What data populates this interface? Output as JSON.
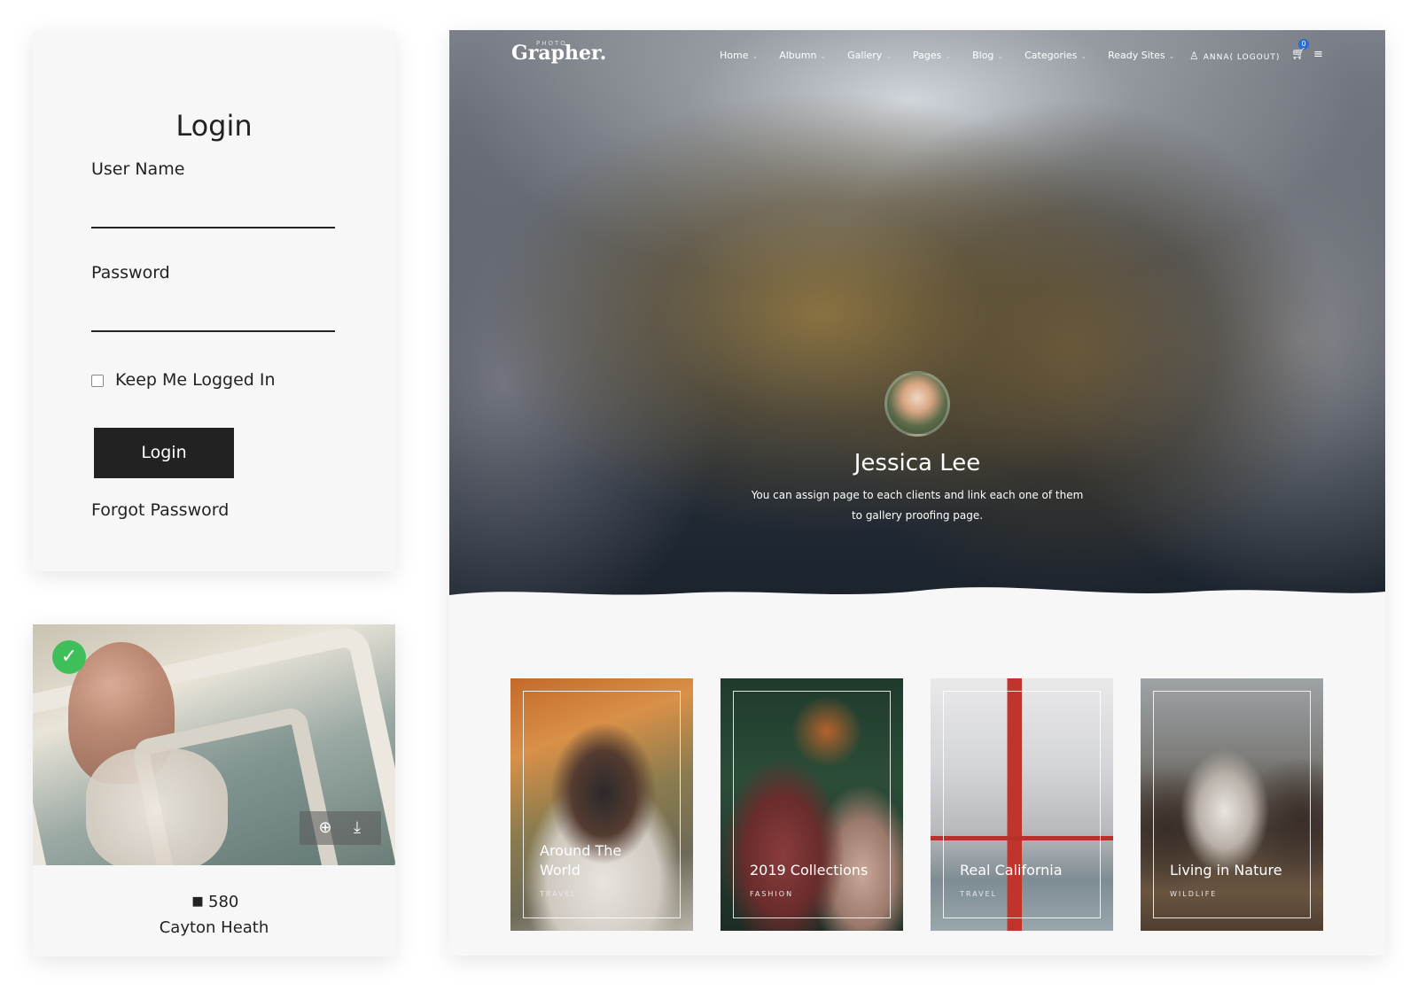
{
  "login": {
    "title": "Login",
    "username_label": "User Name",
    "username_value": "",
    "password_label": "Password",
    "password_value": "",
    "remember_label": "Keep Me Logged In",
    "remember_checked": false,
    "submit_label": "Login",
    "forgot_label": "Forgot Password"
  },
  "photo_card": {
    "tag_count": "580",
    "author": "Cayton Heath",
    "icons": [
      "check-icon",
      "zoom-icon",
      "download-icon",
      "tag-icon"
    ]
  },
  "site": {
    "logo_small": "PHOTO",
    "logo": "Grapher.",
    "nav": [
      "Home",
      "Albumn",
      "Gallery",
      "Pages",
      "Blog",
      "Categories",
      "Ready Sites"
    ],
    "user_link": "ANNA( LOGOUT)",
    "cart_count": "0",
    "hero": {
      "name": "Jessica Lee",
      "description": "You can assign page to each clients and link each one of them to gallery proofing page."
    },
    "categories": [
      {
        "title": "Around The World",
        "subtitle": "TRAVEL"
      },
      {
        "title": "2019 Collections",
        "subtitle": "FASHION"
      },
      {
        "title": "Real California",
        "subtitle": "TRAVEL"
      },
      {
        "title": "Living in Nature",
        "subtitle": "WILDLIFE"
      }
    ]
  }
}
